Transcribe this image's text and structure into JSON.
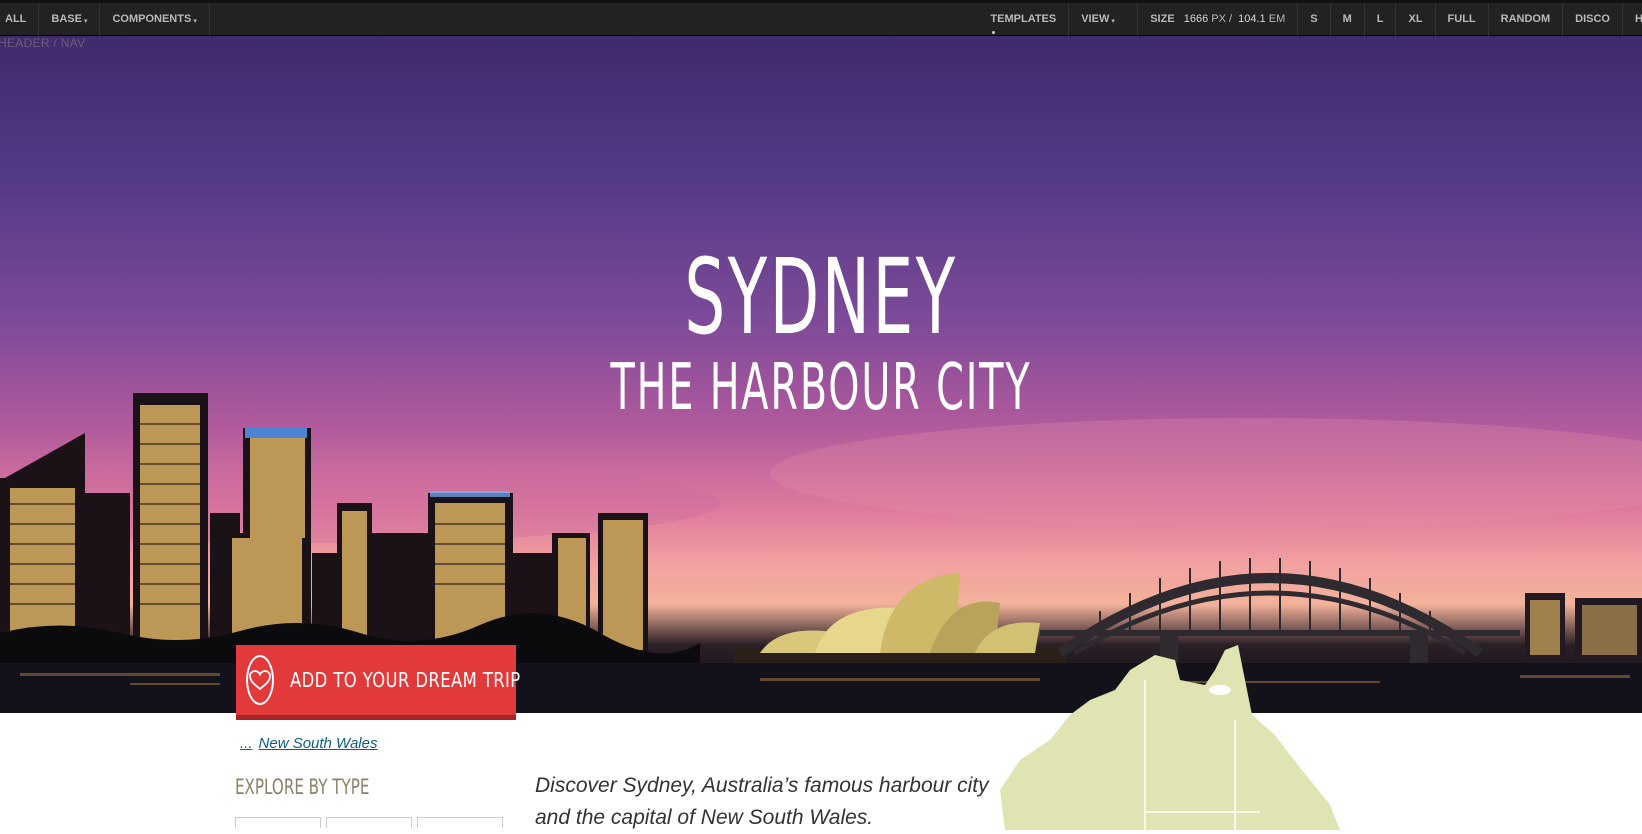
{
  "toolbar": {
    "left_items": [
      {
        "label": "ALL",
        "has_caret": false
      },
      {
        "label": "BASE",
        "has_caret": true
      },
      {
        "label": "COMPONENTS",
        "has_caret": true
      }
    ],
    "templates_label": "TEMPLATES",
    "view_label": "VIEW",
    "size_label": "SIZE",
    "size_px_value": "1666",
    "size_px_unit": "PX /",
    "size_em_value": "104.1",
    "size_em_unit": "EM",
    "size_buttons": [
      "S",
      "M",
      "L",
      "XL",
      "FULL",
      "RANDOM",
      "DISCO",
      "H"
    ]
  },
  "overlay_label": "HEADER / NAV",
  "hero": {
    "title": "Sydney",
    "subtitle": "the Harbour City"
  },
  "dream_trip": {
    "label": "Add to your dream trip",
    "icon": "heart-icon"
  },
  "breadcrumb": {
    "ellipsis": "...",
    "link": "New South Wales"
  },
  "explore_heading": "Explore by type",
  "intro_text": "Discover Sydney, Australia’s famous harbour city and the capital of New South Wales.",
  "colors": {
    "toolbar_bg": "#222222",
    "accent_red": "#e23a3a",
    "map_fill": "#dfe4b2",
    "link_blue": "#0d5e83"
  }
}
